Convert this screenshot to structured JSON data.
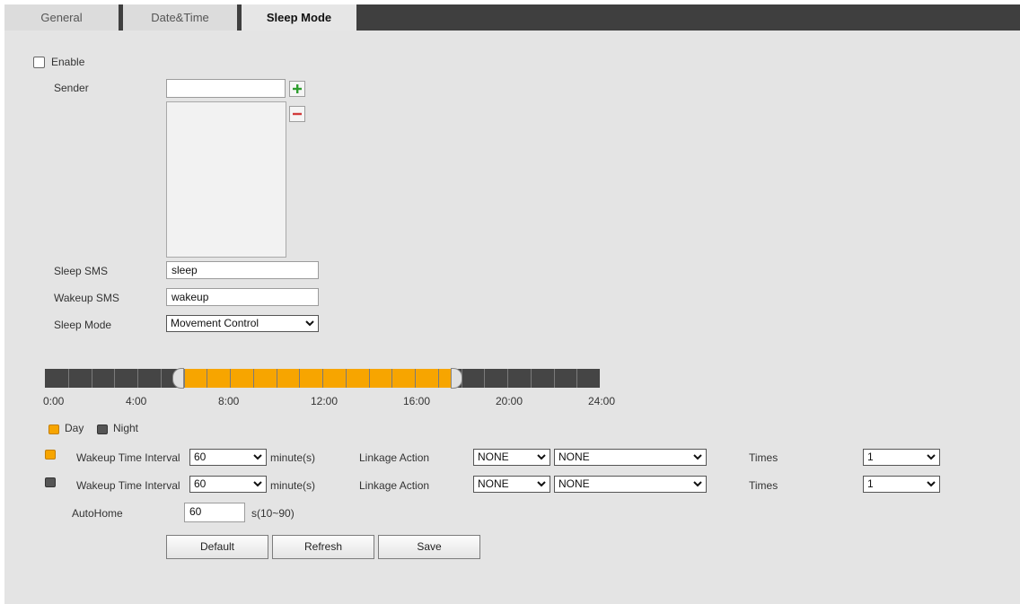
{
  "tabs": [
    {
      "label": "General"
    },
    {
      "label": "Date&Time"
    },
    {
      "label": "Sleep Mode"
    }
  ],
  "form": {
    "enable_label": "Enable",
    "enable_checked": false,
    "sender_label": "Sender",
    "sender_value": "",
    "add_icon": "plus-icon",
    "remove_icon": "minus-icon",
    "sleep_sms_label": "Sleep SMS",
    "sleep_sms_value": "sleep",
    "wakeup_sms_label": "Wakeup SMS",
    "wakeup_sms_value": "wakeup",
    "sleep_mode_label": "Sleep Mode",
    "sleep_mode_value": "Movement Control"
  },
  "timeline": {
    "ticks": [
      "0:00",
      "4:00",
      "8:00",
      "12:00",
      "16:00",
      "20:00",
      "24:00"
    ],
    "day_start": "5:48",
    "day_end": "17:48",
    "colors": {
      "day": "#f7a500",
      "night": "#454545"
    }
  },
  "legend": {
    "day_label": "Day",
    "night_label": "Night"
  },
  "rows": [
    {
      "period": "day",
      "interval_label": "Wakeup Time Interval",
      "interval_value": "60",
      "unit": "minute(s)",
      "linkage_label": "Linkage Action",
      "linkage_value1": "NONE",
      "linkage_value2": "NONE",
      "times_label": "Times",
      "times_value": "1"
    },
    {
      "period": "night",
      "interval_label": "Wakeup Time Interval",
      "interval_value": "60",
      "unit": "minute(s)",
      "linkage_label": "Linkage Action",
      "linkage_value1": "NONE",
      "linkage_value2": "NONE",
      "times_label": "Times",
      "times_value": "1"
    }
  ],
  "autohome": {
    "label": "AutoHome",
    "value": "60",
    "range": "s(10~90)"
  },
  "buttons": {
    "default": "Default",
    "refresh": "Refresh",
    "save": "Save"
  }
}
